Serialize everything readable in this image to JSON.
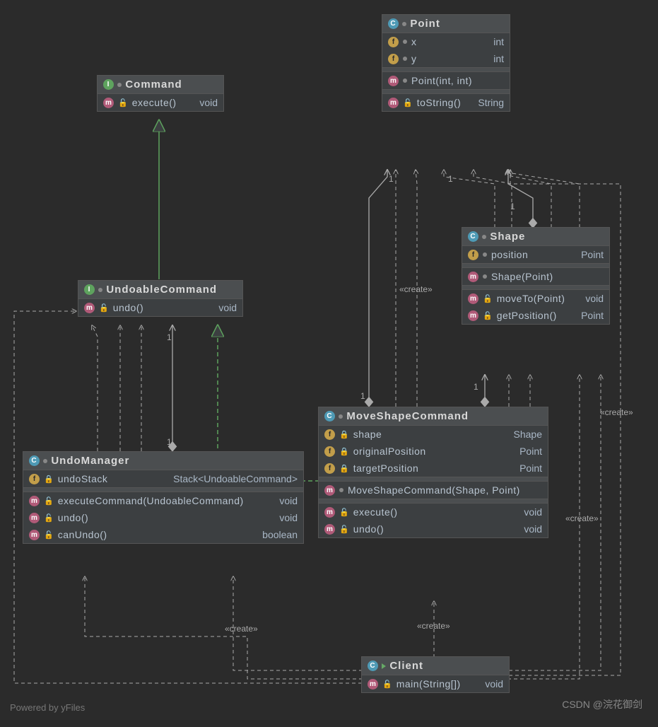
{
  "classes": {
    "command": {
      "kind": "I",
      "name": "Command",
      "methods": [
        {
          "vis": "pub",
          "sig": "execute()",
          "ret": "void"
        }
      ]
    },
    "undoableCommand": {
      "kind": "I",
      "name": "UndoableCommand",
      "methods": [
        {
          "vis": "pub",
          "sig": "undo()",
          "ret": "void"
        }
      ]
    },
    "undoManager": {
      "kind": "C",
      "name": "UndoManager",
      "fields": [
        {
          "vis": "priv",
          "name": "undoStack",
          "type": "Stack<UndoableCommand>"
        }
      ],
      "methods": [
        {
          "vis": "pub",
          "sig": "executeCommand(UndoableCommand)",
          "ret": "void"
        },
        {
          "vis": "pub",
          "sig": "undo()",
          "ret": "void"
        },
        {
          "vis": "pub",
          "sig": "canUndo()",
          "ret": "boolean"
        }
      ]
    },
    "point": {
      "kind": "C",
      "name": "Point",
      "fields": [
        {
          "vis": "pkg",
          "name": "x",
          "type": "int"
        },
        {
          "vis": "pkg",
          "name": "y",
          "type": "int"
        }
      ],
      "constructors": [
        {
          "sig": "Point(int, int)"
        }
      ],
      "methods": [
        {
          "vis": "pub",
          "sig": "toString()",
          "ret": "String"
        }
      ]
    },
    "shape": {
      "kind": "C",
      "name": "Shape",
      "fields": [
        {
          "vis": "pkg",
          "name": "position",
          "type": "Point"
        }
      ],
      "constructors": [
        {
          "sig": "Shape(Point)"
        }
      ],
      "methods": [
        {
          "vis": "pub",
          "sig": "moveTo(Point)",
          "ret": "void"
        },
        {
          "vis": "pub",
          "sig": "getPosition()",
          "ret": "Point"
        }
      ]
    },
    "moveShapeCommand": {
      "kind": "C",
      "name": "MoveShapeCommand",
      "fields": [
        {
          "vis": "priv",
          "name": "shape",
          "type": "Shape"
        },
        {
          "vis": "priv",
          "name": "originalPosition",
          "type": "Point"
        },
        {
          "vis": "priv",
          "name": "targetPosition",
          "type": "Point"
        }
      ],
      "constructors": [
        {
          "sig": "MoveShapeCommand(Shape, Point)"
        }
      ],
      "methods": [
        {
          "vis": "pub",
          "sig": "execute()",
          "ret": "void"
        },
        {
          "vis": "pub",
          "sig": "undo()",
          "ret": "void"
        }
      ]
    },
    "client": {
      "kind": "C",
      "name": "Client",
      "run": true,
      "methods": [
        {
          "vis": "pub",
          "sig": "main(String[])",
          "ret": "void"
        }
      ]
    }
  },
  "labels": {
    "create": "«create»",
    "one": "1"
  },
  "watermarks": {
    "left": "Powered by yFiles",
    "right": "CSDN @浣花御剑"
  }
}
